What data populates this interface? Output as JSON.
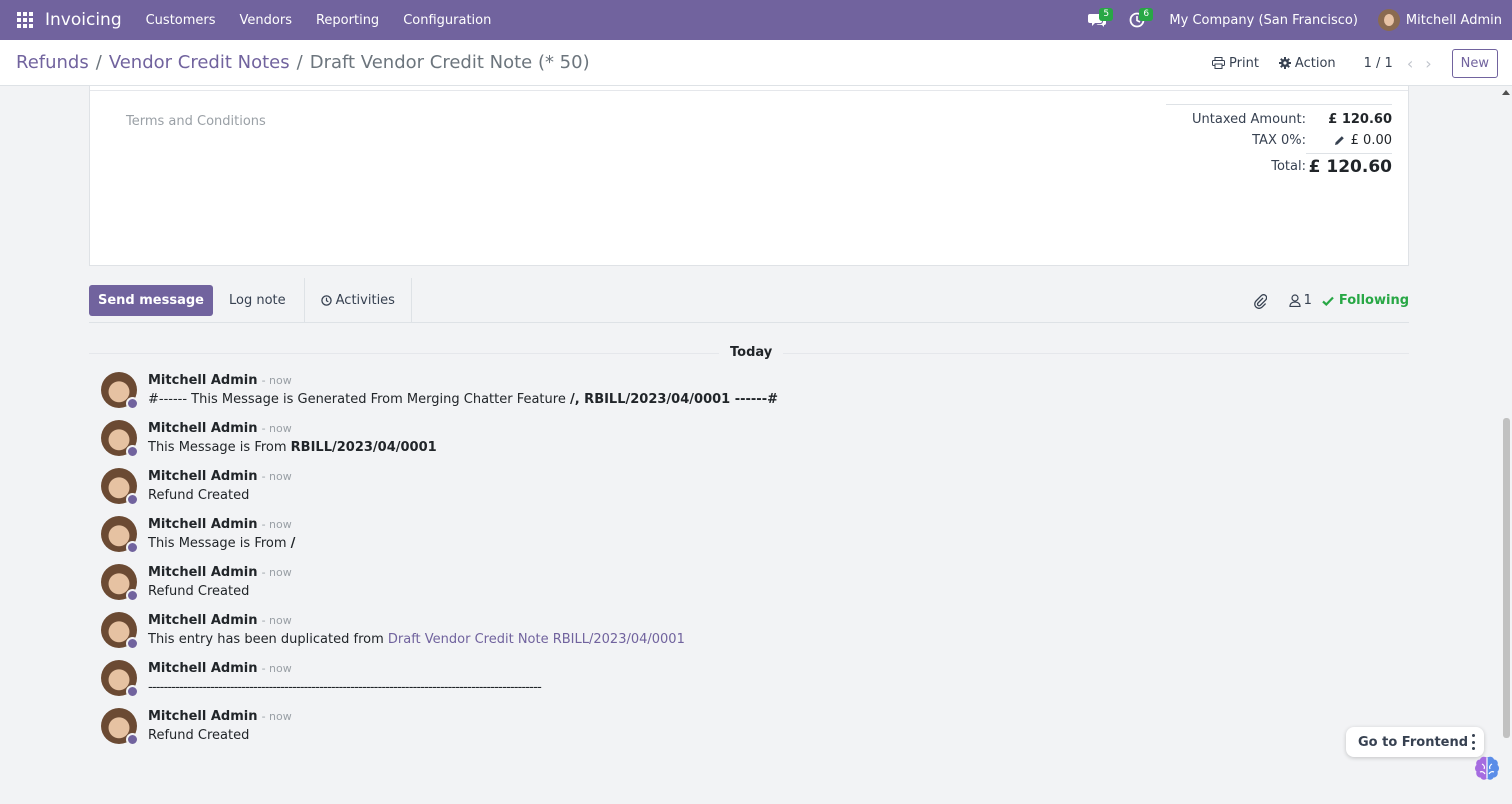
{
  "navbar": {
    "brand": "Invoicing",
    "menu": [
      "Customers",
      "Vendors",
      "Reporting",
      "Configuration"
    ],
    "messages_count": "5",
    "activities_count": "6",
    "company": "My Company (San Francisco)",
    "user": "Mitchell Admin",
    "accent_color": "#71639e"
  },
  "breadcrumb": {
    "items": [
      "Refunds",
      "Vendor Credit Notes"
    ],
    "current": "Draft Vendor Credit Note (* 50)"
  },
  "control": {
    "print_label": "Print",
    "action_label": "Action",
    "pager": "1 / 1",
    "new_label": "New"
  },
  "sheet": {
    "terms_placeholder": "Terms and Conditions",
    "totals": {
      "untaxed_label": "Untaxed Amount:",
      "untaxed_value": "£ 120.60",
      "tax_label": "TAX 0%:",
      "tax_value": "£ 0.00",
      "total_label": "Total:",
      "total_value": "£ 120.60"
    }
  },
  "chatter": {
    "send_message": "Send message",
    "log_note": "Log note",
    "activities": "Activities",
    "followers_count": "1",
    "following": "Following",
    "day": "Today",
    "messages": [
      {
        "author": "Mitchell Admin",
        "when": "- now",
        "body_pre": "#------ This Message is Generated From Merging Chatter Feature ",
        "body_bold": "/, RBILL/2023/04/0001 ------#",
        "body_link": ""
      },
      {
        "author": "Mitchell Admin",
        "when": "- now",
        "body_pre": "This Message is From ",
        "body_bold": "RBILL/2023/04/0001",
        "body_link": ""
      },
      {
        "author": "Mitchell Admin",
        "when": "- now",
        "body_pre": "Refund Created",
        "body_bold": "",
        "body_link": ""
      },
      {
        "author": "Mitchell Admin",
        "when": "- now",
        "body_pre": "This Message is From ",
        "body_bold": "/",
        "body_link": ""
      },
      {
        "author": "Mitchell Admin",
        "when": "- now",
        "body_pre": "Refund Created",
        "body_bold": "",
        "body_link": ""
      },
      {
        "author": "Mitchell Admin",
        "when": "- now",
        "body_pre": "This entry has been duplicated from ",
        "body_bold": "",
        "body_link": "Draft Vendor Credit Note RBILL/2023/04/0001"
      },
      {
        "author": "Mitchell Admin",
        "when": "- now",
        "body_pre": "-----------------------------------------------------------------------------------------------------",
        "body_bold": "",
        "body_link": ""
      },
      {
        "author": "Mitchell Admin",
        "when": "- now",
        "body_pre": "Refund Created",
        "body_bold": "",
        "body_link": ""
      }
    ]
  },
  "floating": {
    "go_to_frontend": "Go to Frontend"
  }
}
